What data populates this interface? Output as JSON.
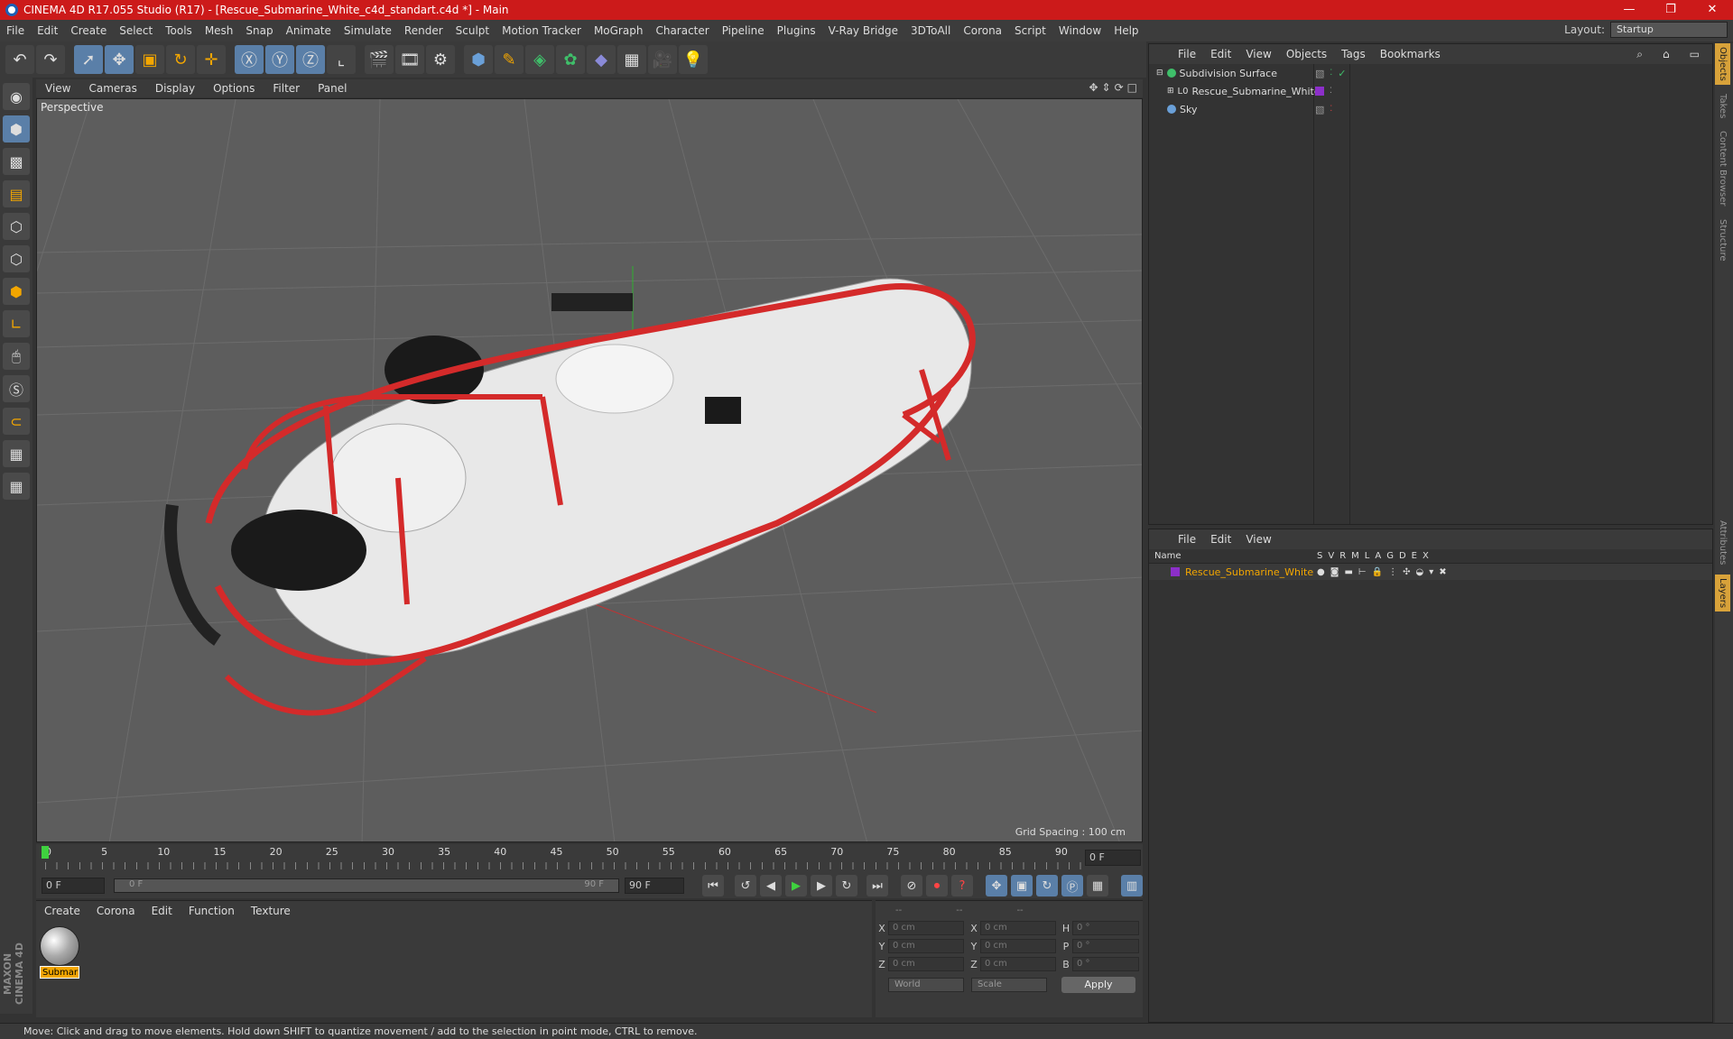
{
  "titlebar": {
    "title": "CINEMA 4D R17.055 Studio (R17) - [Rescue_Submarine_White_c4d_standart.c4d *] - Main",
    "minimize": "—",
    "restore": "❐",
    "close": "✕"
  },
  "menubar": {
    "items": [
      "File",
      "Edit",
      "Create",
      "Select",
      "Tools",
      "Mesh",
      "Snap",
      "Animate",
      "Simulate",
      "Render",
      "Sculpt",
      "Motion Tracker",
      "MoGraph",
      "Character",
      "Pipeline",
      "Plugins",
      "V-Ray Bridge",
      "3DToAll",
      "Corona",
      "Script",
      "Window",
      "Help"
    ],
    "layout_label": "Layout:",
    "layout_value": "Startup"
  },
  "viewport": {
    "menu": [
      "View",
      "Cameras",
      "Display",
      "Options",
      "Filter",
      "Panel"
    ],
    "label": "Perspective",
    "grid_spacing": "Grid Spacing : 100 cm"
  },
  "timeline": {
    "ticks": [
      "0",
      "5",
      "10",
      "15",
      "20",
      "25",
      "30",
      "35",
      "40",
      "45",
      "50",
      "55",
      "60",
      "65",
      "70",
      "75",
      "80",
      "85",
      "90"
    ],
    "current_frame": "0 F"
  },
  "transport": {
    "start": "0 F",
    "range_start": "0 F",
    "range_end": "90 F",
    "end": "90 F"
  },
  "material_panel": {
    "menu": [
      "Create",
      "Corona",
      "Edit",
      "Function",
      "Texture"
    ],
    "material_name": "Submari"
  },
  "coord_panel": {
    "headers": [
      "--",
      "--",
      "--"
    ],
    "rows": [
      {
        "a1": "X",
        "v1": "0 cm",
        "a2": "X",
        "v2": "0 cm",
        "a3": "H",
        "v3": "0 °"
      },
      {
        "a1": "Y",
        "v1": "0 cm",
        "a2": "Y",
        "v2": "0 cm",
        "a3": "P",
        "v3": "0 °"
      },
      {
        "a1": "Z",
        "v1": "0 cm",
        "a2": "Z",
        "v2": "0 cm",
        "a3": "B",
        "v3": "0 °"
      }
    ],
    "world": "World",
    "scale": "Scale",
    "apply": "Apply"
  },
  "status": "Move: Click and drag to move elements. Hold down SHIFT to quantize movement / add to the selection in point mode, CTRL to remove.",
  "object_panel": {
    "menu": [
      "File",
      "Edit",
      "View",
      "Objects",
      "Tags",
      "Bookmarks"
    ],
    "objects": [
      {
        "name": "Subdivision Surface",
        "icon_color": "#3fbf6a"
      },
      {
        "name": "Rescue_Submarine_White",
        "icon_color": "#cfcfcf",
        "tag_color": "#8c2fc9"
      },
      {
        "name": "Sky",
        "icon_color": "#6aa0d8"
      }
    ]
  },
  "layer_panel": {
    "menu": [
      "File",
      "Edit",
      "View"
    ],
    "columns": [
      "Name",
      "S",
      "V",
      "R",
      "M",
      "L",
      "A",
      "G",
      "D",
      "E",
      "X"
    ],
    "layer_name": "Rescue_Submarine_White",
    "layer_color": "#8c2fc9"
  },
  "right_tabs": [
    "Objects",
    "Takes",
    "Content Browser",
    "Structure",
    "Attributes",
    "Layers"
  ],
  "logo": "MAXON CINEMA 4D"
}
